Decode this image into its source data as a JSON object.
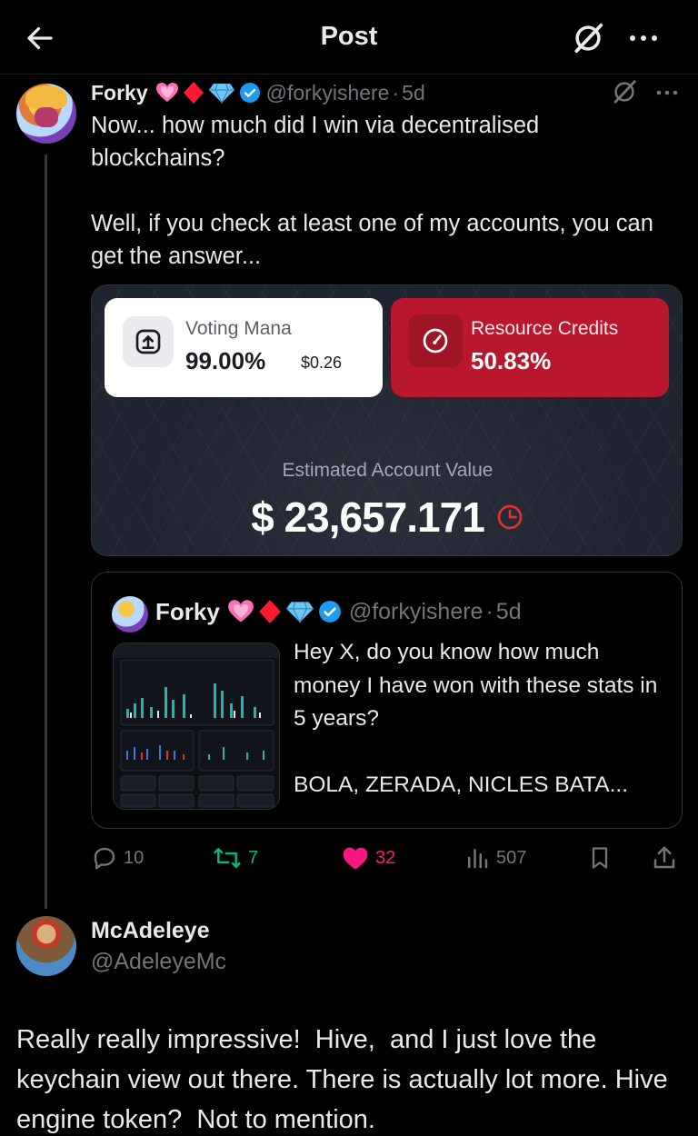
{
  "header": {
    "title": "Post"
  },
  "post": {
    "author": "Forky",
    "handle": "@forkyishere",
    "time": "5d",
    "dot": "·",
    "text": "Now... how much did I win via decentralised blockchains?\n\nWell, if you check at least one of my accounts, you can get the answer...",
    "media": {
      "voting_mana_label": "Voting Mana",
      "voting_mana_value": "99.00%",
      "voting_mana_usd": "$0.26",
      "resource_credits_label": "Resource Credits",
      "resource_credits_value": "50.83%",
      "estimated_label": "Estimated Account Value",
      "estimated_value": "$ 23,657.171"
    },
    "quote": {
      "author": "Forky",
      "handle": "@forkyishere",
      "time": "5d",
      "text": "Hey X, do you know how much money I have won with these stats in 5 years?\n\nBOLA, ZERADA, NICLES BATA..."
    },
    "stats": {
      "replies": "10",
      "reposts": "7",
      "likes": "32",
      "views": "507"
    }
  },
  "reply": {
    "author": "McAdeleye",
    "handle": "@AdeleyeMc",
    "text": "Really really impressive!  Hive,  and I just love the keychain view out there. There is actually lot more. Hive engine token?  Not to mention."
  },
  "icons": {
    "back": "arrow-left-icon",
    "grok": "grok-icon",
    "more": "more-dots-icon",
    "verified": "verified-badge-icon",
    "reply": "reply-icon",
    "repost": "repost-icon",
    "like": "heart-icon",
    "views": "views-icon",
    "bookmark": "bookmark-icon",
    "share": "share-icon"
  },
  "colors": {
    "background": "#000000",
    "text": "#e7e9ea",
    "muted": "#71767b",
    "verified": "#1d9bf0",
    "repost": "#00ba7c",
    "like": "#f91880",
    "resource_card": "#b9172e"
  }
}
